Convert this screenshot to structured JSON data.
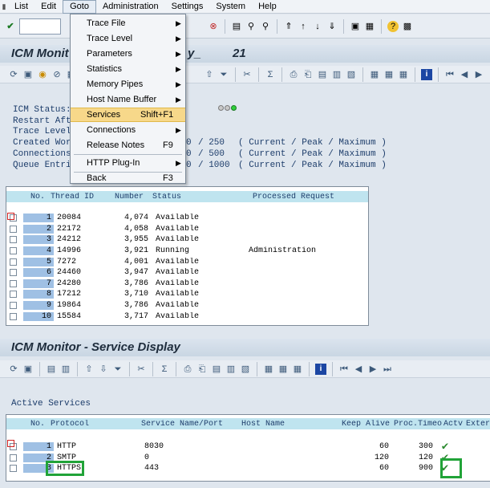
{
  "menubar": {
    "items": [
      "List",
      "Edit",
      "Goto",
      "Administration",
      "Settings",
      "System",
      "Help"
    ]
  },
  "goto_menu": {
    "items": [
      {
        "label": "Trace File",
        "shortcut": "",
        "submenu": true
      },
      {
        "label": "Trace Level",
        "shortcut": "",
        "submenu": true
      },
      {
        "label": "Parameters",
        "shortcut": "",
        "submenu": true
      },
      {
        "label": "Statistics",
        "shortcut": "",
        "submenu": true
      },
      {
        "label": "Memory Pipes",
        "shortcut": "",
        "submenu": true
      },
      {
        "label": "Host Name Buffer",
        "shortcut": "",
        "submenu": true
      },
      {
        "label": "Services",
        "shortcut": "Shift+F1",
        "submenu": false,
        "highlighted": true
      },
      {
        "label": "Connections",
        "shortcut": "",
        "submenu": true
      },
      {
        "label": "Release Notes",
        "shortcut": "F9",
        "submenu": false
      },
      {
        "label": "HTTP Plug-In",
        "shortcut": "",
        "submenu": true
      },
      {
        "label": "Back",
        "shortcut": "F3",
        "submenu": false
      }
    ]
  },
  "icm_monitor": {
    "title_left": "ICM Monit",
    "title_right_a": "y_",
    "title_right_b": "21",
    "status_labels": [
      "ICM Status:",
      "Restart Afte",
      "Trace Level",
      "Created Work",
      "Connections",
      "Queue Entri"
    ],
    "ratio_rows": [
      {
        "current": "0",
        "max": "/ 250",
        "note": "( Current / Peak / Maximum )"
      },
      {
        "current": "0",
        "max": "/ 500",
        "note": "( Current / Peak / Maximum )"
      },
      {
        "current": "0",
        "max": "/ 1000",
        "note": "( Current / Peak / Maximum )"
      }
    ],
    "status_lights": [
      "grey",
      "grey",
      "green"
    ]
  },
  "thread_table": {
    "headers": [
      "No.",
      "Thread ID",
      "Number",
      "Status",
      "Processed Request"
    ],
    "rows": [
      {
        "no": "1",
        "thread_id": "20084",
        "number": "4,074",
        "status": "Available",
        "request": ""
      },
      {
        "no": "2",
        "thread_id": "22172",
        "number": "4,058",
        "status": "Available",
        "request": ""
      },
      {
        "no": "3",
        "thread_id": "24212",
        "number": "3,955",
        "status": "Available",
        "request": ""
      },
      {
        "no": "4",
        "thread_id": "14996",
        "number": "3,921",
        "status": "Running",
        "request": "Administration"
      },
      {
        "no": "5",
        "thread_id": "7272",
        "number": "4,001",
        "status": "Available",
        "request": ""
      },
      {
        "no": "6",
        "thread_id": "24460",
        "number": "3,947",
        "status": "Available",
        "request": ""
      },
      {
        "no": "7",
        "thread_id": "24280",
        "number": "3,786",
        "status": "Available",
        "request": ""
      },
      {
        "no": "8",
        "thread_id": "17212",
        "number": "3,710",
        "status": "Available",
        "request": ""
      },
      {
        "no": "9",
        "thread_id": "19864",
        "number": "3,786",
        "status": "Available",
        "request": ""
      },
      {
        "no": "10",
        "thread_id": "15584",
        "number": "3,717",
        "status": "Available",
        "request": ""
      }
    ]
  },
  "service_display": {
    "title": "ICM Monitor - Service Display",
    "section_label": "Active Services",
    "headers": [
      "No.",
      "Protocol",
      "Service Name/Port",
      "Host Name",
      "Keep Alive",
      "Proc.Timeo",
      "Actv",
      "Exter"
    ],
    "rows": [
      {
        "no": "1",
        "protocol": "HTTP",
        "port": "8030",
        "host": "",
        "keep_alive": "60",
        "proc_timeout": "300",
        "active": true
      },
      {
        "no": "2",
        "protocol": "SMTP",
        "port": "0",
        "host": "",
        "keep_alive": "120",
        "proc_timeout": "120",
        "active": true
      },
      {
        "no": "3",
        "protocol": "HTTPS",
        "port": "443",
        "host": "",
        "keep_alive": "60",
        "proc_timeout": "900",
        "active": true
      }
    ]
  },
  "colors": {
    "highlight": "#f7d88a",
    "annotation_green": "#21a338",
    "header_blue": "#bfe4ef",
    "row_number_blue": "#9fc0e4"
  }
}
